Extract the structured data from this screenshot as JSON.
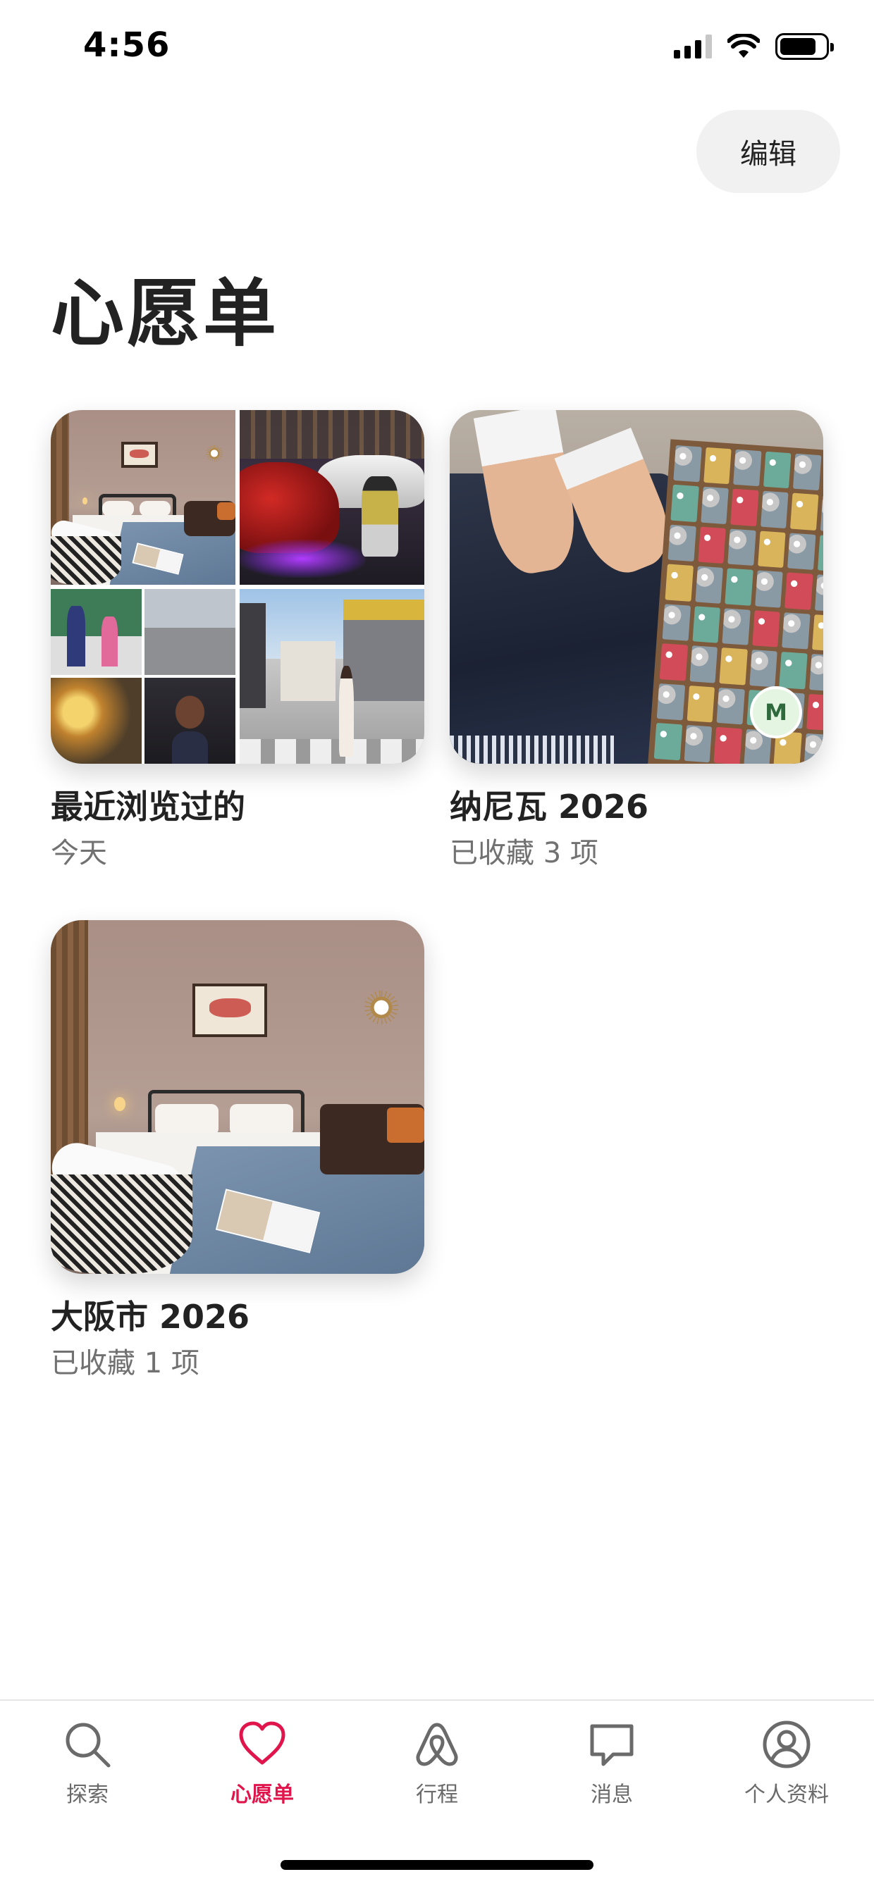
{
  "status_bar": {
    "time": "4:56"
  },
  "header": {
    "edit_label": "编辑",
    "title": "心愿单"
  },
  "wishlists": [
    {
      "title": "最近浏览过的",
      "subtitle": "今天"
    },
    {
      "title": "纳尼瓦 2026",
      "subtitle": "已收藏 3 项",
      "collaborator_initial": "M"
    },
    {
      "title": "大阪市 2026",
      "subtitle": "已收藏 1 项"
    }
  ],
  "bottom_nav": {
    "active_color": "#e0154c",
    "items": [
      {
        "label": "探索",
        "icon": "search-icon"
      },
      {
        "label": "心愿单",
        "icon": "heart-icon",
        "active": true
      },
      {
        "label": "行程",
        "icon": "airbnb-logo-icon"
      },
      {
        "label": "消息",
        "icon": "message-icon"
      },
      {
        "label": "个人资料",
        "icon": "profile-icon"
      }
    ]
  }
}
